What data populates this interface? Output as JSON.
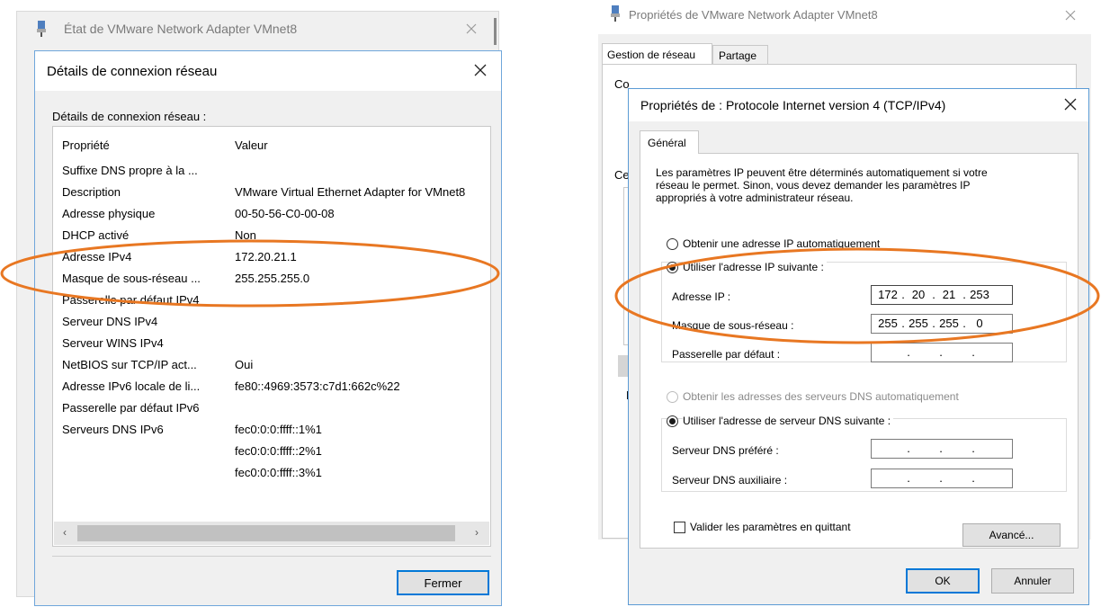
{
  "left": {
    "bg_title": "État de VMware Network Adapter VMnet8",
    "dialog_title": "Détails de connexion réseau",
    "section_label": "Détails de connexion réseau :",
    "headers": {
      "prop": "Propriété",
      "val": "Valeur"
    },
    "rows": [
      {
        "p": "Suffixe DNS propre à la ...",
        "v": ""
      },
      {
        "p": "Description",
        "v": "VMware Virtual Ethernet Adapter for VMnet8"
      },
      {
        "p": "Adresse physique",
        "v": "00-50-56-C0-00-08"
      },
      {
        "p": "DHCP activé",
        "v": "Non"
      },
      {
        "p": "Adresse IPv4",
        "v": "172.20.21.1"
      },
      {
        "p": "Masque de sous-réseau ...",
        "v": "255.255.255.0"
      },
      {
        "p": "Passerelle par défaut IPv4",
        "v": ""
      },
      {
        "p": "Serveur DNS IPv4",
        "v": ""
      },
      {
        "p": "Serveur WINS IPv4",
        "v": ""
      },
      {
        "p": "NetBIOS sur TCP/IP act...",
        "v": "Oui"
      },
      {
        "p": "Adresse IPv6 locale de li...",
        "v": "fe80::4969:3573:c7d1:662c%22"
      },
      {
        "p": "Passerelle par défaut IPv6",
        "v": ""
      },
      {
        "p": "Serveurs DNS IPv6",
        "v": "fec0:0:0:ffff::1%1"
      },
      {
        "p": "",
        "v": "fec0:0:0:ffff::2%1"
      },
      {
        "p": "",
        "v": "fec0:0:0:ffff::3%1"
      }
    ],
    "close_label": "Fermer"
  },
  "right": {
    "bg_title": "Propriétés de VMware Network Adapter VMnet8",
    "bg_tabs": [
      "Gestion de réseau",
      "Partage"
    ],
    "bg_peek1": "Co",
    "bg_peek2": "Ce",
    "bg_peek3": "D",
    "dialog_title": "Propriétés de : Protocole Internet version 4 (TCP/IPv4)",
    "tab": "Général",
    "intro": [
      "Les paramètres IP peuvent être déterminés automatiquement si votre",
      "réseau le permet. Sinon, vous devez demander les paramètres IP",
      "appropriés à votre administrateur réseau."
    ],
    "radio_auto_ip": "Obtenir une adresse IP automatiquement",
    "radio_manual_ip": "Utiliser l'adresse IP suivante :",
    "ip_label": "Adresse IP :",
    "ip_octets": [
      "172",
      "20",
      "21",
      "253"
    ],
    "mask_label": "Masque de sous-réseau :",
    "mask_octets": [
      "255",
      "255",
      "255",
      "0"
    ],
    "gw_label": "Passerelle par défaut :",
    "radio_auto_dns": "Obtenir les adresses des serveurs DNS automatiquement",
    "radio_manual_dns": "Utiliser l'adresse de serveur DNS suivante :",
    "dns1_label": "Serveur DNS préféré :",
    "dns2_label": "Serveur DNS auxiliaire :",
    "validate_label": "Valider les paramètres en quittant",
    "advanced_label": "Avancé...",
    "ok_label": "OK",
    "cancel_label": "Annuler"
  },
  "colors": {
    "accent": "#0078d7",
    "annotation": "#e87722",
    "window_bg": "#f0f0f0",
    "dialog_border": "#5b9bd5"
  },
  "icons": {
    "adapter": "network-adapter-icon",
    "close": "close-icon"
  }
}
